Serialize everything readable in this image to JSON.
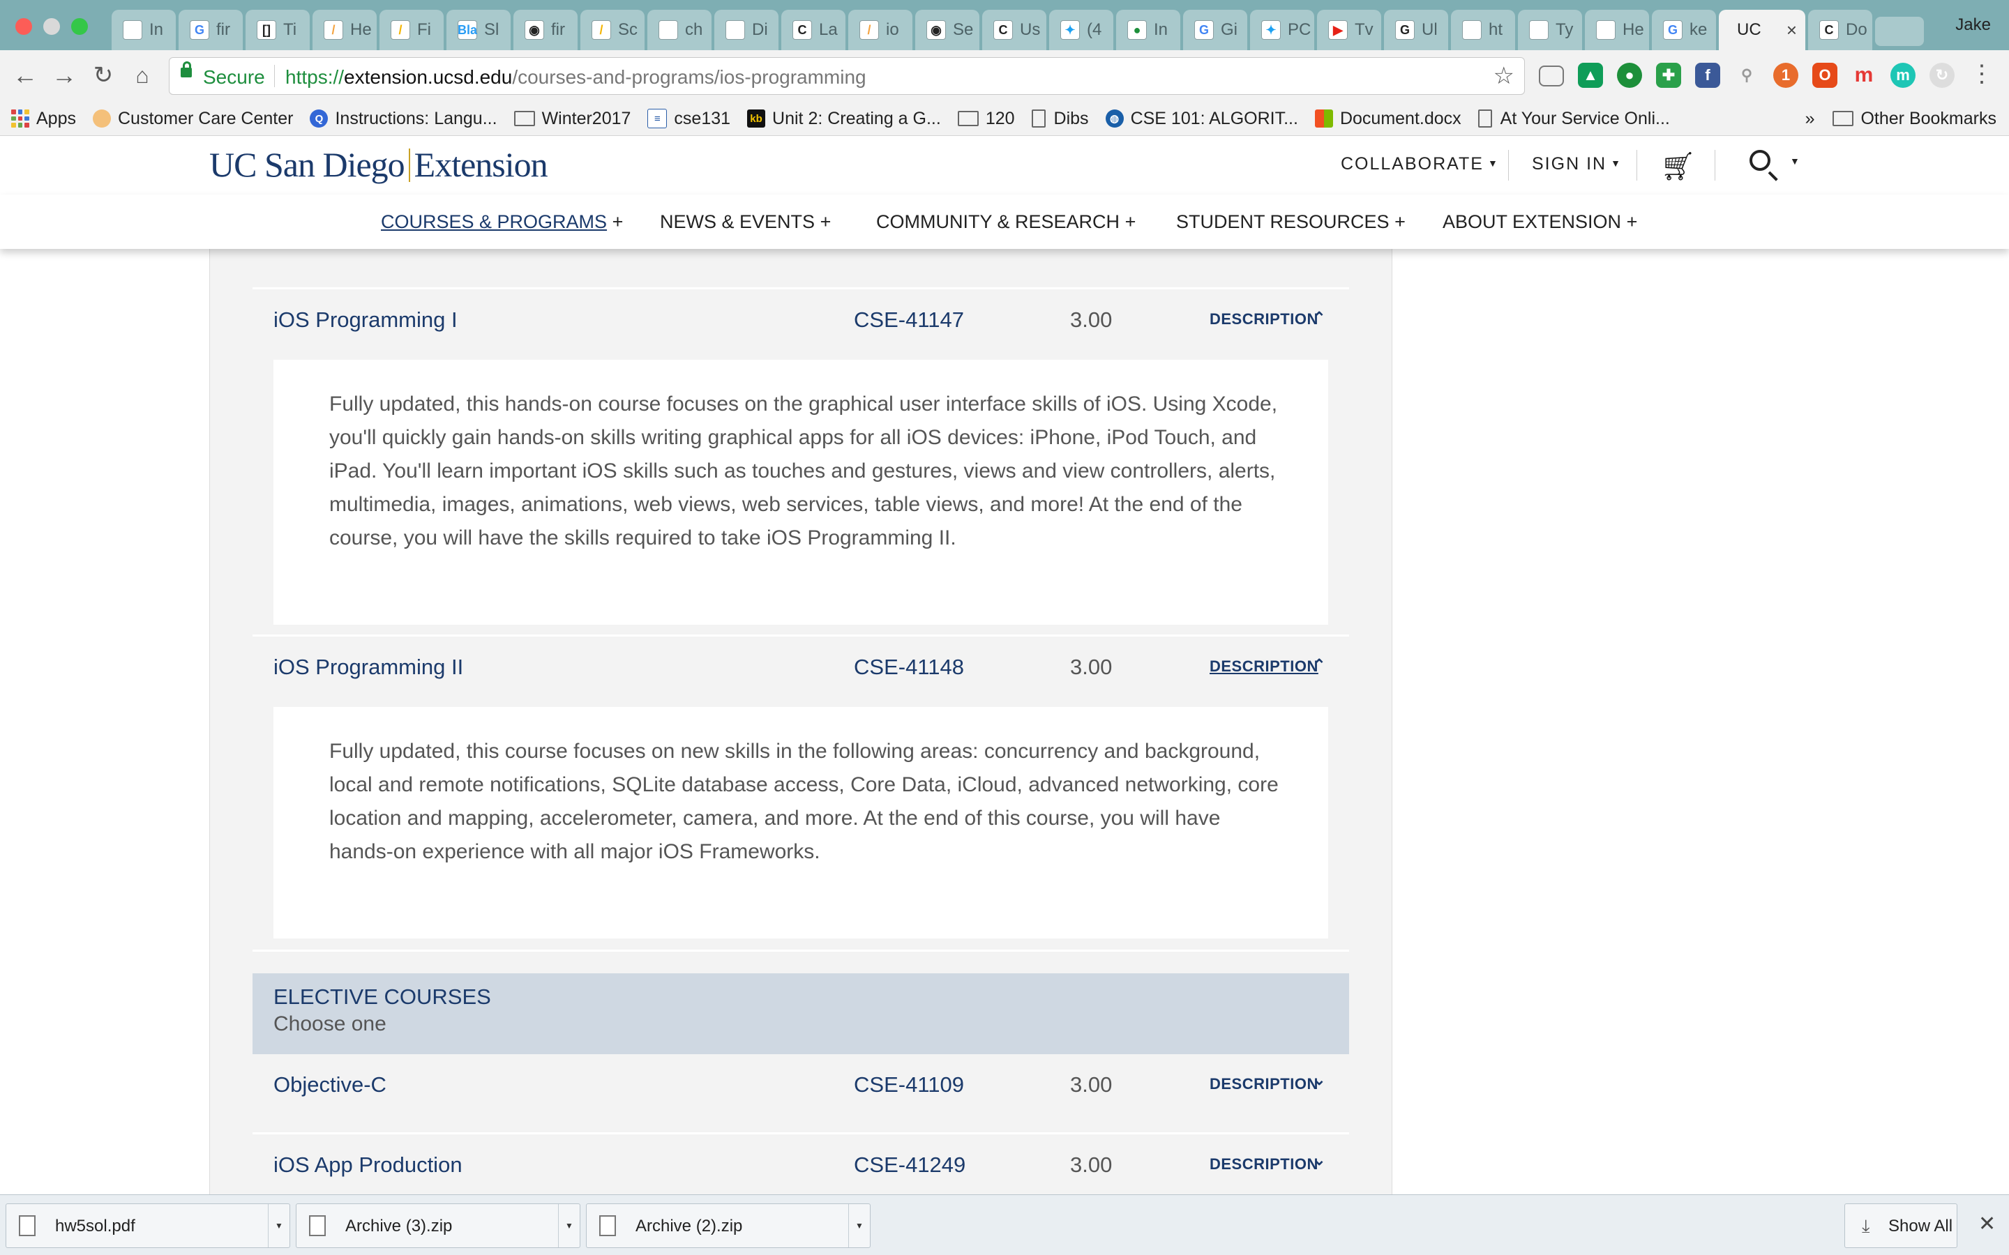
{
  "browser": {
    "tabs": [
      {
        "label": "In",
        "icon": "page-icon",
        "glyph": "",
        "color": "#ffffff"
      },
      {
        "label": "fir",
        "icon": "google-icon",
        "glyph": "G",
        "color": "#4285f4"
      },
      {
        "label": "Ti",
        "icon": "brackets-icon",
        "glyph": "[]",
        "color": "#222222"
      },
      {
        "label": "He",
        "icon": "orange-icon",
        "glyph": "/",
        "color": "#f4a340"
      },
      {
        "label": "Fi",
        "icon": "drive-icon",
        "glyph": "/",
        "color": "#f4b400"
      },
      {
        "label": "Sl",
        "icon": "blabla-icon",
        "glyph": "Bla",
        "color": "#2a9df4"
      },
      {
        "label": "fir",
        "icon": "github-icon",
        "glyph": "◉",
        "color": "#222222"
      },
      {
        "label": "Sc",
        "icon": "drive-icon",
        "glyph": "/",
        "color": "#f4b400"
      },
      {
        "label": "ch",
        "icon": "page-icon",
        "glyph": "",
        "color": "#ffffff"
      },
      {
        "label": "Di",
        "icon": "page-icon",
        "glyph": "",
        "color": "#ffffff"
      },
      {
        "label": "La",
        "icon": "c-icon",
        "glyph": "C",
        "color": "#222222"
      },
      {
        "label": "io",
        "icon": "orange-icon",
        "glyph": "/",
        "color": "#f4a340"
      },
      {
        "label": "Se",
        "icon": "github-icon",
        "glyph": "◉",
        "color": "#222222"
      },
      {
        "label": "Us",
        "icon": "c-icon",
        "glyph": "C",
        "color": "#222222"
      },
      {
        "label": "(4",
        "icon": "twitter-icon",
        "glyph": "✦",
        "color": "#1da1f2"
      },
      {
        "label": "In",
        "icon": "green-dot-icon",
        "glyph": "●",
        "color": "#1d8f3a"
      },
      {
        "label": "Gi",
        "icon": "google-icon",
        "glyph": "G",
        "color": "#4285f4"
      },
      {
        "label": "PC",
        "icon": "twitter-icon",
        "glyph": "✦",
        "color": "#1da1f2"
      },
      {
        "label": "Tv",
        "icon": "youtube-icon",
        "glyph": "▶",
        "color": "#e62117"
      },
      {
        "label": "Ul",
        "icon": "g-icon",
        "glyph": "G",
        "color": "#222222"
      },
      {
        "label": "ht",
        "icon": "page-icon",
        "glyph": "",
        "color": "#ffffff"
      },
      {
        "label": "Ty",
        "icon": "page-icon",
        "glyph": "",
        "color": "#ffffff"
      },
      {
        "label": "He",
        "icon": "page-icon",
        "glyph": "",
        "color": "#ffffff"
      },
      {
        "label": "ke",
        "icon": "google-icon",
        "glyph": "G",
        "color": "#4285f4"
      },
      {
        "label": "UC",
        "icon": "",
        "glyph": "",
        "color": "#ffffff",
        "active": true
      },
      {
        "label": "Do",
        "icon": "c-icon",
        "glyph": "C",
        "color": "#222222"
      }
    ],
    "profile_name": "Jake",
    "secure_label": "Secure",
    "url_scheme": "https://",
    "url_host": "extension.ucsd.edu",
    "url_path": "/courses-and-programs/ios-programming"
  },
  "bookmarks": {
    "items": [
      {
        "label": "Apps",
        "icon": "apps-grid-icon"
      },
      {
        "label": "Customer Care Center",
        "icon": "customer-care-icon"
      },
      {
        "label": "Instructions: Langu...",
        "icon": "q-icon"
      },
      {
        "label": "Winter2017",
        "icon": "folder-icon"
      },
      {
        "label": "cse131",
        "icon": "cse131-icon"
      },
      {
        "label": "Unit 2: Creating a G...",
        "icon": "kb-icon"
      },
      {
        "label": "120",
        "icon": "folder-icon"
      },
      {
        "label": "Dibs",
        "icon": "page-icon"
      },
      {
        "label": "CSE 101: ALGORIT...",
        "icon": "globe-icon"
      },
      {
        "label": "Document.docx",
        "icon": "microsoft-icon"
      },
      {
        "label": "At Your Service Onli...",
        "icon": "page-icon"
      }
    ],
    "overflow": "»",
    "other": "Other Bookmarks"
  },
  "site": {
    "logo_left": "UC San Diego",
    "logo_right": "Extension",
    "collaborate": "COLLABORATE",
    "sign_in": "SIGN IN",
    "nav": [
      {
        "label": "COURSES & PROGRAMS",
        "plus": "+",
        "active": true
      },
      {
        "label": "NEWS & EVENTS",
        "plus": "+"
      },
      {
        "label": "COMMUNITY & RESEARCH",
        "plus": "+"
      },
      {
        "label": "STUDENT RESOURCES",
        "plus": "+"
      },
      {
        "label": "ABOUT EXTENSION",
        "plus": "+"
      }
    ]
  },
  "courses": {
    "description_label": "DESCRIPTION",
    "rows": [
      {
        "name": "iOS Programming I",
        "code": "CSE-41147",
        "units": "3.00",
        "expanded": true,
        "description": "Fully updated, this hands-on course focuses on the graphical user interface skills of iOS. Using Xcode, you'll quickly gain hands-on skills writing graphical apps for all iOS devices: iPhone, iPod Touch, and iPad. You'll learn important iOS skills such as touches and gestures, views and view controllers, alerts, multimedia, images, animations, web views, web services, table views, and more! At the end of the course, you will have the skills required to take iOS Programming II."
      },
      {
        "name": "iOS Programming II",
        "code": "CSE-41148",
        "units": "3.00",
        "expanded": true,
        "description": "Fully updated, this course focuses on new skills in the following areas: concurrency and background, local and remote notifications, SQLite database access, Core Data, iCloud, advanced networking, core location and mapping, accelerometer, camera, and more. At the end of this course, you will have hands-on experience with all major iOS Frameworks."
      }
    ],
    "elective": {
      "title": "ELECTIVE COURSES",
      "subtitle": "Choose one",
      "rows": [
        {
          "name": "Objective-C",
          "code": "CSE-41109",
          "units": "3.00",
          "expanded": false
        },
        {
          "name": "iOS App Production",
          "code": "CSE-41249",
          "units": "3.00",
          "expanded": false
        }
      ]
    }
  },
  "downloads": {
    "items": [
      {
        "name": "hw5sol.pdf"
      },
      {
        "name": "Archive (3).zip"
      },
      {
        "name": "Archive (2).zip"
      }
    ],
    "show_all": "Show All"
  },
  "colors": {
    "brand_navy": "#1b3a6b",
    "brand_gold": "#c9a227",
    "secure_green": "#1e8e3e",
    "elective_bg": "#cfd8e2"
  }
}
